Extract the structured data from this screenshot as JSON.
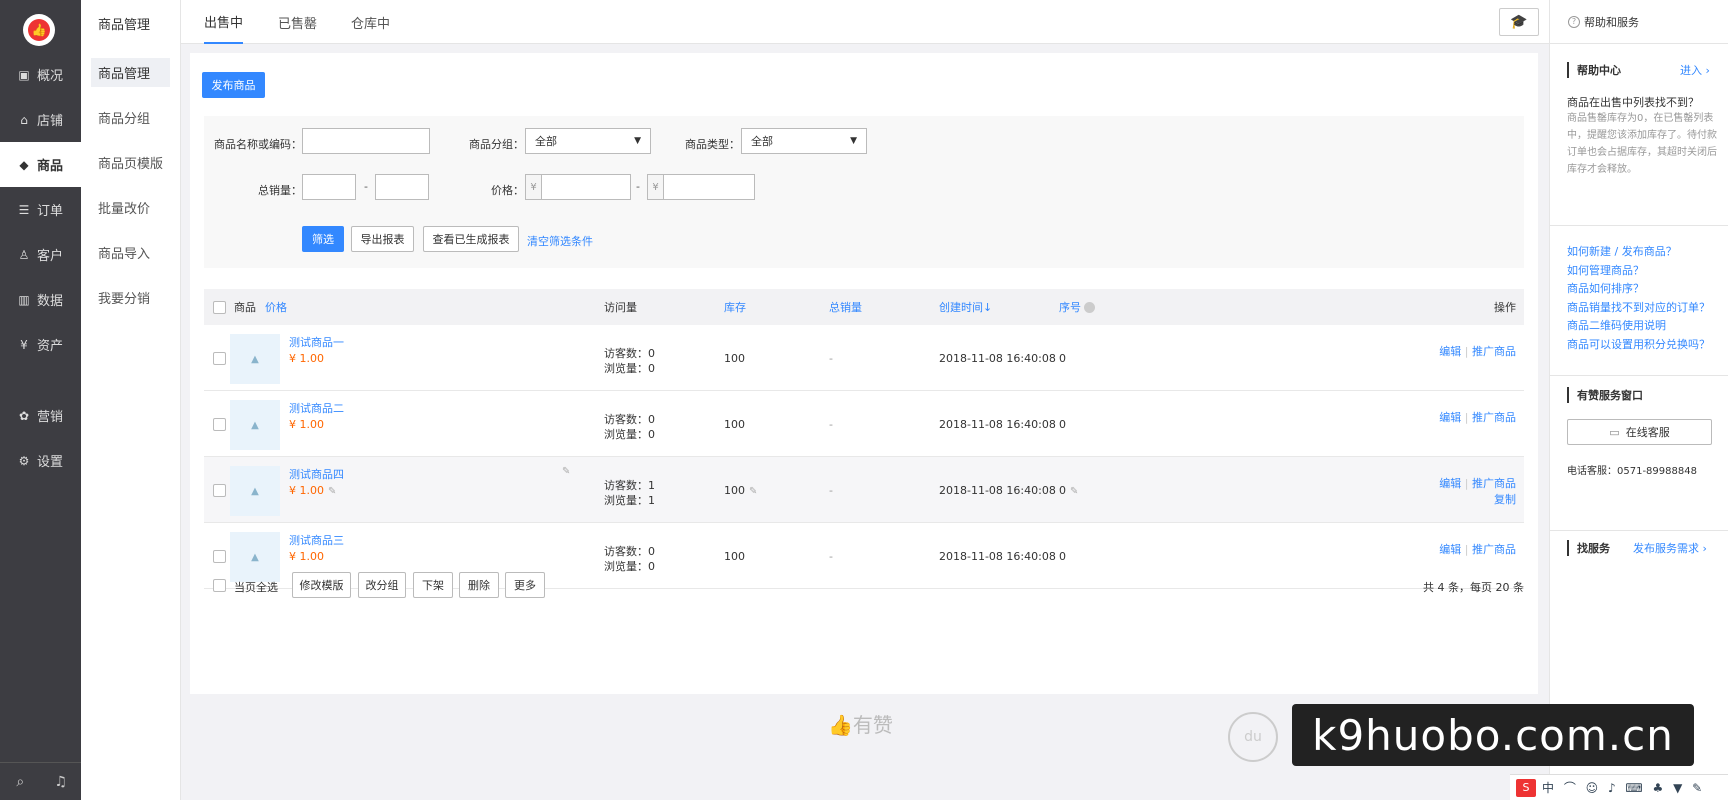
{
  "sidebar": {
    "items": [
      {
        "icon": "chart-icon",
        "glyph": "▣",
        "label": "概况"
      },
      {
        "icon": "store-icon",
        "glyph": "⌂",
        "label": "店铺"
      },
      {
        "icon": "tag-icon",
        "glyph": "◆",
        "label": "商品"
      },
      {
        "icon": "order-icon",
        "glyph": "☰",
        "label": "订单"
      },
      {
        "icon": "user-icon",
        "glyph": "♙",
        "label": "客户"
      },
      {
        "icon": "bar-chart-icon",
        "glyph": "▥",
        "label": "数据"
      },
      {
        "icon": "yen-icon",
        "glyph": "¥",
        "label": "资产"
      },
      {
        "icon": "marketing-icon",
        "glyph": "✿",
        "label": "营销"
      },
      {
        "icon": "gear-icon",
        "glyph": "⚙",
        "label": "设置"
      }
    ],
    "bottom": {
      "search": "⌕",
      "bell": "♫"
    }
  },
  "subnav": {
    "title": "商品管理",
    "items": [
      "商品管理",
      "商品分组",
      "商品页模版",
      "批量改价",
      "商品导入",
      "我要分销"
    ]
  },
  "tabs": [
    "出售中",
    "已售罄",
    "仓库中"
  ],
  "main": {
    "publish_button": "发布商品",
    "filter": {
      "name_label": "商品名称或编码：",
      "group_label": "商品分组：",
      "group_value": "全部",
      "type_label": "商品类型：",
      "type_value": "全部",
      "sales_label": "总销量：",
      "sales_dash": "-",
      "price_label": "价格：",
      "currency": "¥",
      "price_dash": "-",
      "filter_button": "筛选",
      "export_button": "导出报表",
      "view_reports_button": "查看已生成报表",
      "clear_link": "清空筛选条件"
    },
    "table": {
      "headers": {
        "product": "商品",
        "price": "价格",
        "visits": "访问量",
        "stock": "库存",
        "sales": "总销量",
        "created": "创建时间↓",
        "order": "序号",
        "ops": "操作"
      },
      "rows": [
        {
          "name": "测试商品一",
          "price": "¥ 1.00",
          "visitors": "访客数：0",
          "views": "浏览量：0",
          "stock": "100",
          "sales": "-",
          "created": "2018-11-08 16:40:08",
          "order": "0",
          "edit": "编辑",
          "sep": "|",
          "promote": "推广商品",
          "copy": ""
        },
        {
          "name": "测试商品二",
          "price": "¥ 1.00",
          "visitors": "访客数：0",
          "views": "浏览量：0",
          "stock": "100",
          "sales": "-",
          "created": "2018-11-08 16:40:08",
          "order": "0",
          "edit": "编辑",
          "sep": "|",
          "promote": "推广商品",
          "copy": ""
        },
        {
          "name": "测试商品四",
          "price": "¥ 1.00",
          "visitors": "访客数：1",
          "views": "浏览量：1",
          "stock": "100",
          "sales": "-",
          "created": "2018-11-08 16:40:08",
          "order": "0",
          "edit": "编辑",
          "sep": "|",
          "promote": "推广商品",
          "copy": "复制"
        },
        {
          "name": "测试商品三",
          "price": "¥ 1.00",
          "visitors": "访客数：0",
          "views": "浏览量：0",
          "stock": "100",
          "sales": "-",
          "created": "2018-11-08 16:40:08",
          "order": "0",
          "edit": "编辑",
          "sep": "|",
          "promote": "推广商品",
          "copy": ""
        }
      ]
    },
    "bulk": {
      "select_all": "当页全选",
      "change_template": "修改模版",
      "change_group": "改分组",
      "unlist": "下架",
      "delete": "删除",
      "more": "更多",
      "summary": "共 4 条，每页 20 条"
    },
    "watermark": "有赞"
  },
  "right_panel": {
    "header": "帮助和服务",
    "help_center": "帮助中心",
    "enter": "进入",
    "question_title": "商品在出售中列表找不到？",
    "question_body": "商品售罄库存为0，在已售罄列表中，提醒您该添加库存了。待付款订单也会占据库存，其超时关闭后库存才会释放。",
    "links": [
      "如何新建 / 发布商品？",
      "如何管理商品？",
      "商品如何排序？",
      "商品销量找不到对应的订单？",
      "商品二维码使用说明",
      "商品可以设置用积分兑换吗？"
    ],
    "service_window": "有赞服务窗口",
    "online_service": "在线客服",
    "phone": "电话客服：0571-89988848",
    "find_service": "找服务",
    "publish_need": "发布服务需求"
  },
  "overlay": {
    "banner": "k9huobo.com.cn",
    "baidu": "du",
    "ime_logo": "S",
    "ime_text": "中 ⌒ ☺ ♪ ⌨ ♣ ▼ ✎"
  },
  "colors": {
    "accent": "#3388ff",
    "sidebar": "#3d3d42",
    "price": "#ff6600"
  }
}
